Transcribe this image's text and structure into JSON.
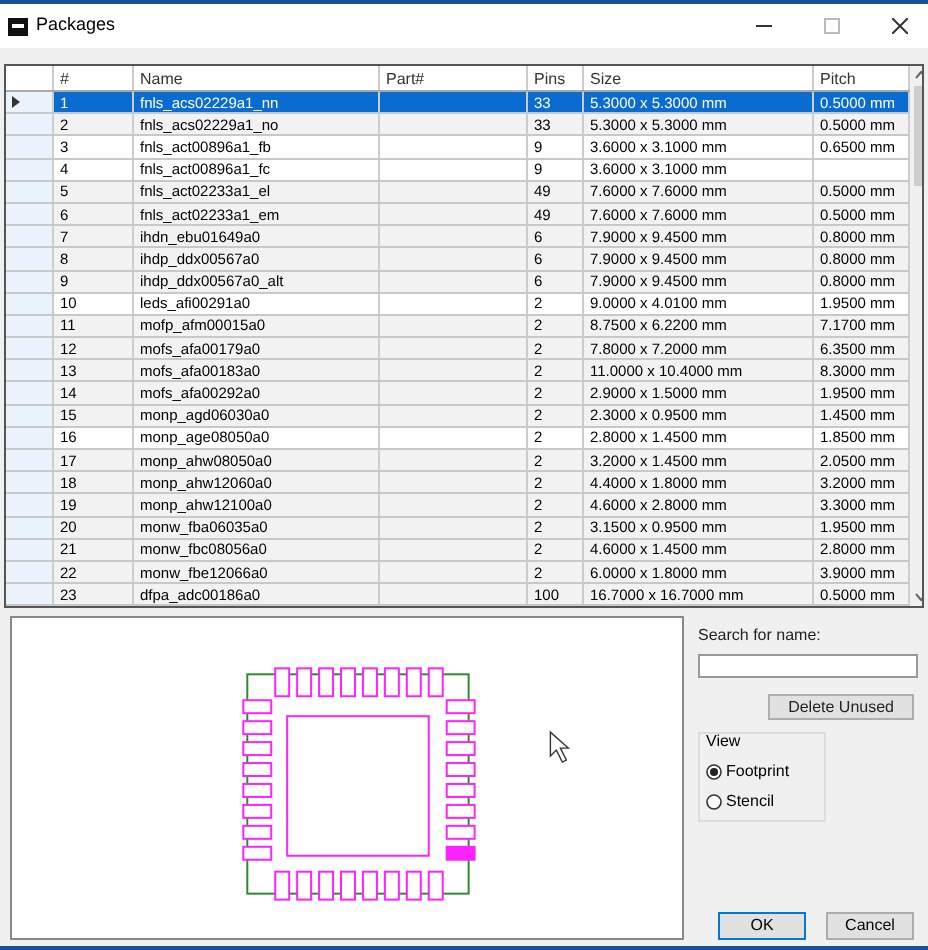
{
  "window": {
    "title": "Packages"
  },
  "table": {
    "columns": [
      "#",
      "Name",
      "Part#",
      "Pins",
      "Size",
      "Pitch"
    ],
    "rows": [
      {
        "cells": [
          "1",
          "fnls_acs02229a1_nn",
          "",
          "33",
          "5.3000 x 5.3000 mm",
          "0.5000 mm"
        ],
        "selected": true
      },
      {
        "cells": [
          "2",
          "fnls_acs02229a1_no",
          "",
          "33",
          "5.3000 x 5.3000 mm",
          "0.5000 mm"
        ],
        "selected": false,
        "shaded": true
      },
      {
        "cells": [
          "3",
          "fnls_act00896a1_fb",
          "",
          "9",
          "3.6000 x 3.1000 mm",
          "0.6500 mm"
        ],
        "selected": false,
        "shaded": false
      },
      {
        "cells": [
          "4",
          "fnls_act00896a1_fc",
          "",
          "9",
          "3.6000 x 3.1000 mm",
          ""
        ],
        "selected": false,
        "shaded": false
      },
      {
        "cells": [
          "5",
          "fnls_act02233a1_el",
          "",
          "49",
          "7.6000 x 7.6000 mm",
          "0.5000 mm"
        ],
        "selected": false,
        "shaded": true
      },
      {
        "cells": [
          "6",
          "fnls_act02233a1_em",
          "",
          "49",
          "7.6000 x 7.6000 mm",
          "0.5000 mm"
        ],
        "selected": false,
        "shaded": true
      },
      {
        "cells": [
          "7",
          "ihdn_ebu01649a0",
          "",
          "6",
          "7.9000 x 9.4500 mm",
          "0.8000 mm"
        ],
        "selected": false,
        "shaded": true
      },
      {
        "cells": [
          "8",
          "ihdp_ddx00567a0",
          "",
          "6",
          "7.9000 x 9.4500 mm",
          "0.8000 mm"
        ],
        "selected": false,
        "shaded": true
      },
      {
        "cells": [
          "9",
          "ihdp_ddx00567a0_alt",
          "",
          "6",
          "7.9000 x 9.4500 mm",
          "0.8000 mm"
        ],
        "selected": false,
        "shaded": true
      },
      {
        "cells": [
          "10",
          "leds_afi00291a0",
          "",
          "2",
          "9.0000 x 4.0100 mm",
          "1.9500 mm"
        ],
        "selected": false,
        "shaded": false
      },
      {
        "cells": [
          "11",
          "mofp_afm00015a0",
          "",
          "2",
          "8.7500 x 6.2200 mm",
          "7.1700 mm"
        ],
        "selected": false,
        "shaded": true
      },
      {
        "cells": [
          "12",
          "mofs_afa00179a0",
          "",
          "2",
          "7.8000 x 7.2000 mm",
          "6.3500 mm"
        ],
        "selected": false,
        "shaded": true
      },
      {
        "cells": [
          "13",
          "mofs_afa00183a0",
          "",
          "2",
          "11.0000 x 10.4000 mm",
          "8.3000 mm"
        ],
        "selected": false,
        "shaded": true
      },
      {
        "cells": [
          "14",
          "mofs_afa00292a0",
          "",
          "2",
          "2.9000 x 1.5000 mm",
          "1.9500 mm"
        ],
        "selected": false,
        "shaded": true
      },
      {
        "cells": [
          "15",
          "monp_agd06030a0",
          "",
          "2",
          "2.3000 x 0.9500 mm",
          "1.4500 mm"
        ],
        "selected": false,
        "shaded": true
      },
      {
        "cells": [
          "16",
          "monp_age08050a0",
          "",
          "2",
          "2.8000 x 1.4500 mm",
          "1.8500 mm"
        ],
        "selected": false,
        "shaded": false
      },
      {
        "cells": [
          "17",
          "monp_ahw08050a0",
          "",
          "2",
          "3.2000 x 1.4500 mm",
          "2.0500 mm"
        ],
        "selected": false,
        "shaded": true
      },
      {
        "cells": [
          "18",
          "monp_ahw12060a0",
          "",
          "2",
          "4.4000 x 1.8000 mm",
          "3.2000 mm"
        ],
        "selected": false,
        "shaded": true
      },
      {
        "cells": [
          "19",
          "monp_ahw12100a0",
          "",
          "2",
          "4.6000 x 2.8000 mm",
          "3.3000 mm"
        ],
        "selected": false,
        "shaded": true
      },
      {
        "cells": [
          "20",
          "monw_fba06035a0",
          "",
          "2",
          "3.1500 x 0.9500 mm",
          "1.9500 mm"
        ],
        "selected": false,
        "shaded": true
      },
      {
        "cells": [
          "21",
          "monw_fbc08056a0",
          "",
          "2",
          "4.6000 x 1.4500 mm",
          "2.8000 mm"
        ],
        "selected": false,
        "shaded": true
      },
      {
        "cells": [
          "22",
          "monw_fbe12066a0",
          "",
          "2",
          "6.0000 x 1.8000 mm",
          "3.9000 mm"
        ],
        "selected": false,
        "shaded": true
      },
      {
        "cells": [
          "23",
          "dfpa_adc00186a0",
          "",
          "100",
          "16.7000 x 16.7000 mm",
          "0.5000 mm"
        ],
        "selected": false,
        "shaded": true
      }
    ]
  },
  "search": {
    "label": "Search for name:"
  },
  "delete_button": "Delete Unused",
  "view": {
    "title": "View",
    "options": [
      {
        "label": "Footprint",
        "selected": true
      },
      {
        "label": "Stencil",
        "selected": false
      }
    ]
  },
  "buttons": [
    "OK",
    "Cancel"
  ]
}
